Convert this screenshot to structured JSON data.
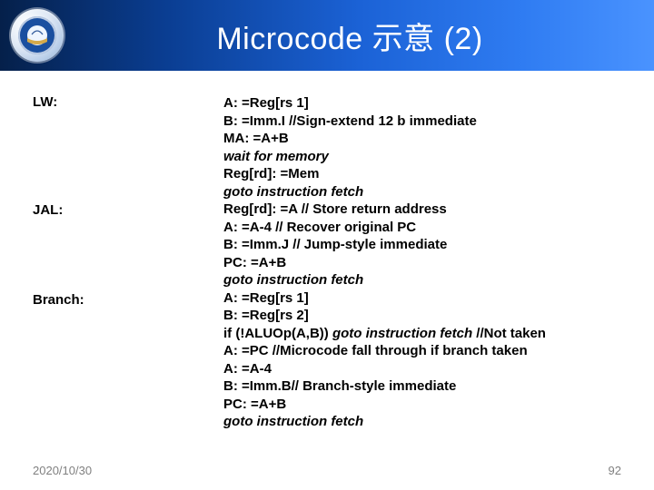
{
  "header": {
    "title": "Microcode 示意 (2)",
    "logo_name": "university-seal"
  },
  "content": {
    "labels": {
      "lw": "LW:",
      "jal": "JAL:",
      "branch": "Branch:"
    },
    "code": {
      "lw": {
        "l1": "A: =Reg[rs 1]",
        "l2": "B: =Imm.I   //Sign-extend 12 b immediate",
        "l3": "MA: =A+B",
        "l4": "wait for memory",
        "l5": "Reg[rd]: =Mem",
        "l6": "goto instruction fetch"
      },
      "jal": {
        "l1": "Reg[rd]: =A  // Store return address",
        "l2": "A: =A-4      // Recover original PC",
        "l3": "B: =Imm.J    // Jump-style immediate",
        "l4": "PC: =A+B",
        "l5": "goto instruction fetch"
      },
      "branch": {
        "l1": "A: =Reg[rs 1]",
        "l2": "B: =Reg[rs 2]",
        "l3a": "if (!ALUOp(A,B)) ",
        "l3b": "goto instruction fetch ",
        "l3c": "//Not taken",
        "l4": "A: =PC  //Microcode fall through if branch taken",
        "l5": "A: =A-4",
        "l6": "B: =Imm.B// Branch-style immediate",
        "l7": "PC: =A+B",
        "l8": "goto instruction fetch"
      }
    }
  },
  "footer": {
    "date": "2020/10/30",
    "page": "92"
  }
}
